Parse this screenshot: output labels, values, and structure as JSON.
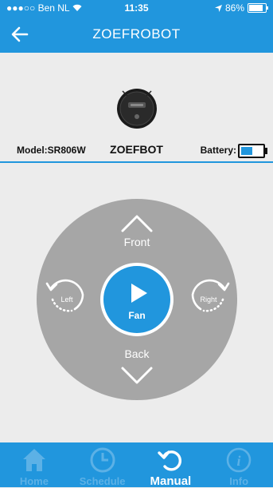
{
  "status_bar": {
    "carrier": "●●●○○ Ben NL",
    "time": "11:35",
    "battery_percent": "86%",
    "battery_level": 0.86
  },
  "nav": {
    "title": "ZOEFROBOT",
    "back_icon": "arrow-left-icon"
  },
  "device": {
    "model": "Model:SR806W",
    "name": "ZOEFBOT",
    "battery_label": "Battery:",
    "battery_level": 0.55
  },
  "controls": {
    "front": "Front",
    "back": "Back",
    "left": "Left",
    "right": "Right",
    "fan": "Fan"
  },
  "tabs": [
    {
      "label": "Home",
      "icon": "house-icon"
    },
    {
      "label": "Schedule",
      "icon": "clock-icon"
    },
    {
      "label": "Manual",
      "icon": "refresh-icon",
      "active": true
    },
    {
      "label": "Info",
      "icon": "info-icon"
    }
  ],
  "colors": {
    "accent": "#2196dd",
    "pad": "#a6a6a6",
    "tab_inactive": "#5cb1e6"
  }
}
